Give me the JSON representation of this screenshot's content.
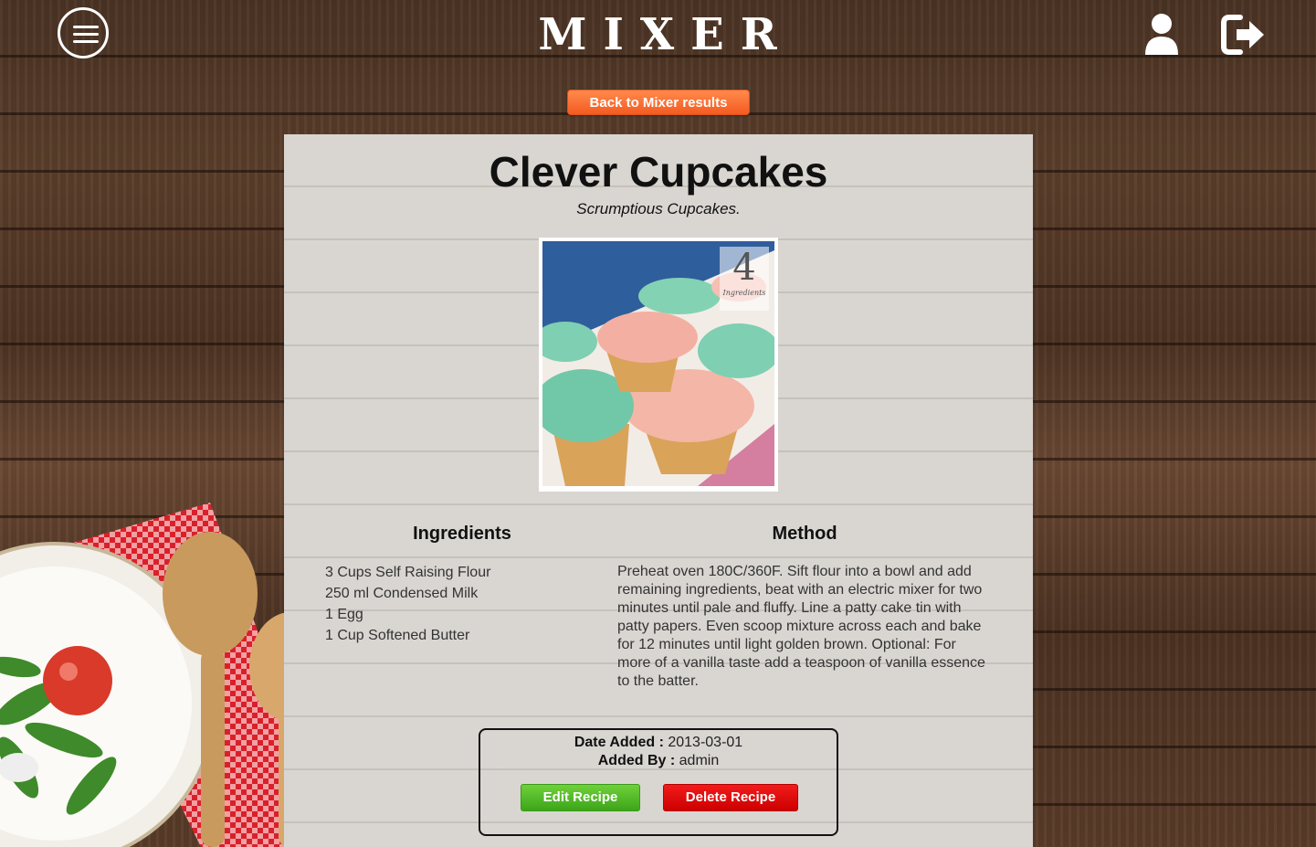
{
  "header": {
    "logo": "MIXER",
    "menu_icon": "hamburger-menu-icon",
    "user_icon": "user-icon",
    "logout_icon": "logout-icon"
  },
  "back_button": {
    "label": "Back to Mixer results"
  },
  "recipe": {
    "title": "Clever Cupcakes",
    "subtitle": "Scrumptious Cupcakes.",
    "image_badge": {
      "number": "4",
      "label": "Ingredients"
    },
    "ingredients_heading": "Ingredients",
    "method_heading": "Method",
    "ingredients": [
      "3 Cups Self Raising Flour",
      "250 ml Condensed Milk",
      "1 Egg",
      "1 Cup Softened Butter"
    ],
    "method": "Preheat oven 180C/360F. Sift flour into a bowl and add remaining ingredients, beat with an electric mixer for two minutes until pale and fluffy. Line a patty cake tin with patty papers. Even scoop mixture across each and bake for 12 minutes until light golden brown. Optional: For more of a vanilla taste add a teaspoon of vanilla essence to the batter."
  },
  "info": {
    "date_label": "Date Added :",
    "date_value": "2013-03-01",
    "added_by_label": "Added By :",
    "added_by_value": "admin",
    "edit_label": "Edit Recipe",
    "delete_label": "Delete Recipe"
  },
  "colors": {
    "back_button": "#f45b21",
    "edit_button": "#3da51a",
    "delete_button": "#cc0000",
    "card_bg": "#d9d6d2"
  }
}
